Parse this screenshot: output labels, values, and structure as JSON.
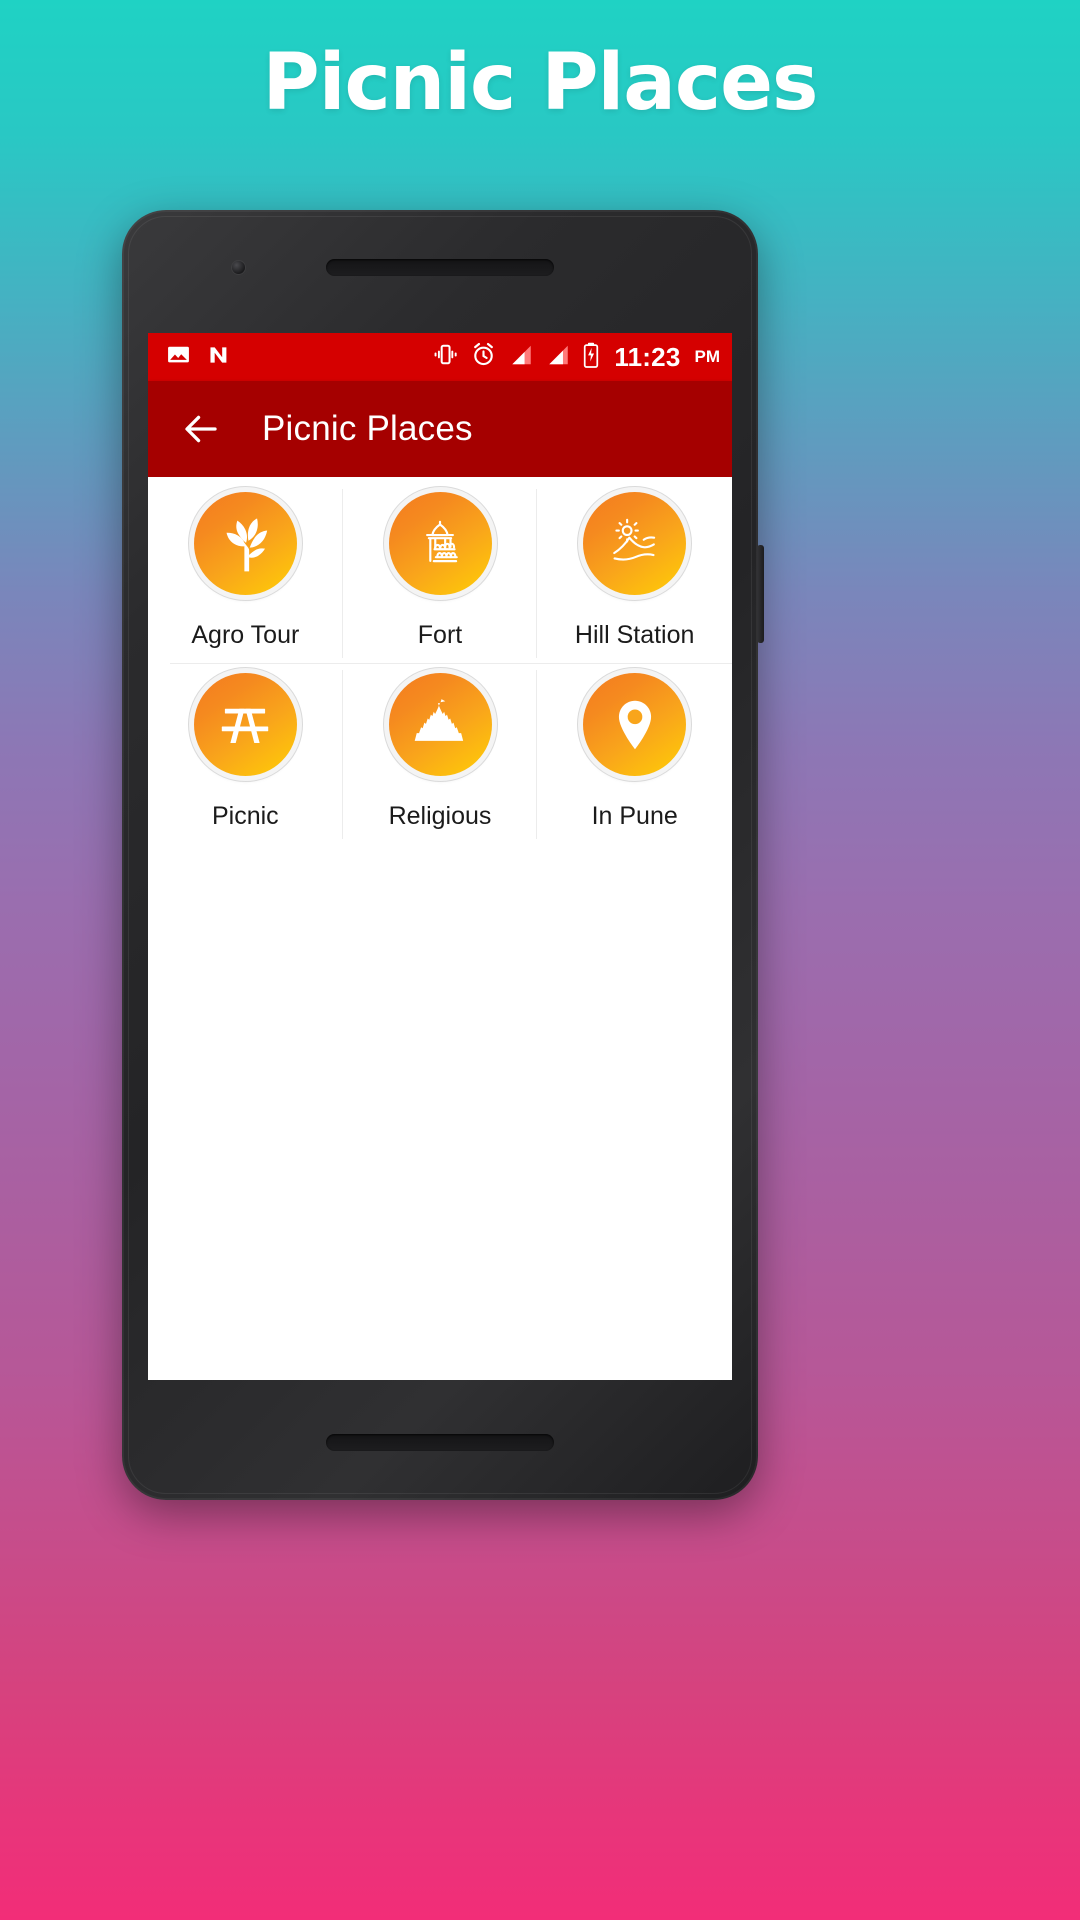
{
  "banner": {
    "title": "Picnic Places"
  },
  "colors": {
    "status_bar": "#D50000",
    "app_bar": "#A50000",
    "icon_gradient_start": "#F47B20",
    "icon_gradient_end": "#FFCC06",
    "screen_background": "#FFFFFF",
    "label_text": "#1B1B1B",
    "bg_gradient_top": "#1FD2C4",
    "bg_gradient_mid": "#9A6EAF",
    "bg_gradient_bottom": "#F22D78"
  },
  "status_bar": {
    "left_icons": [
      "image-icon",
      "nougat-n-icon"
    ],
    "right_icons": [
      "vibrate-icon",
      "alarm-icon",
      "signal-bars-icon",
      "signal-bars-2-icon",
      "battery-icon"
    ],
    "time": "11:23",
    "am_pm": "PM"
  },
  "app_bar": {
    "back_icon": "back-arrow-icon",
    "title": "Picnic Places"
  },
  "grid": {
    "rows": [
      [
        {
          "icon": "plant-leaf-icon",
          "label": "Agro Tour"
        },
        {
          "icon": "fort-building-icon",
          "label": "Fort"
        },
        {
          "icon": "hill-sunrise-icon",
          "label": "Hill Station"
        }
      ],
      [
        {
          "icon": "picnic-table-icon",
          "label": "Picnic"
        },
        {
          "icon": "temple-mountain-icon",
          "label": "Religious"
        },
        {
          "icon": "map-pin-icon",
          "label": "In Pune"
        }
      ]
    ]
  }
}
